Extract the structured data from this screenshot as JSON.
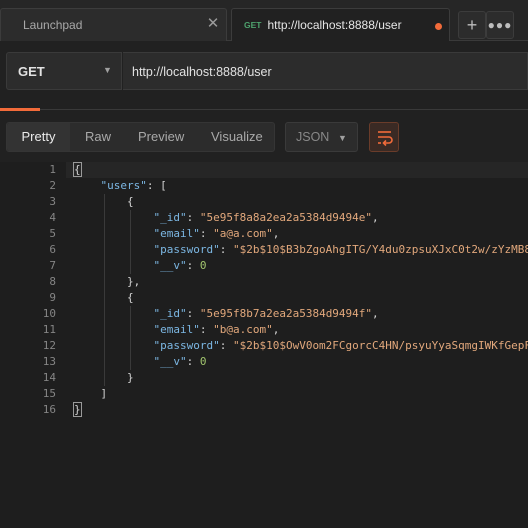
{
  "tabs": [
    {
      "title": "Launchpad"
    },
    {
      "method": "GET",
      "title": "http://localhost:8888/user"
    }
  ],
  "request": {
    "method": "GET",
    "url": "http://localhost:8888/user"
  },
  "viewer": {
    "modes": [
      "Pretty",
      "Raw",
      "Preview",
      "Visualize"
    ],
    "active_mode": "Pretty",
    "format": "JSON"
  },
  "code_lines": [
    "{",
    "    \"users\": [",
    "        {",
    "            \"_id\": \"5e95f8a8a2ea2a5384d9494e\",",
    "            \"email\": \"a@a.com\",",
    "            \"password\": \"$2b$10$B3bZgoAhgITG/Y4du0zpsuXJxC0t2w/zYzMB8",
    "            \"__v\": 0",
    "        },",
    "        {",
    "            \"_id\": \"5e95f8b7a2ea2a5384d9494f\",",
    "            \"email\": \"b@a.com\",",
    "            \"password\": \"$2b$10$OwV0om2FCgorcC4HN/psyuYyaSqmgIWKfGepF",
    "            \"__v\": 0",
    "        }",
    "    ]",
    "}"
  ],
  "colors": {
    "accent": "#f26b3a",
    "get_badge": "#4ea36e",
    "json_key": "#7cb7e3",
    "json_string": "#e2a87c",
    "json_number": "#a2c56e"
  }
}
